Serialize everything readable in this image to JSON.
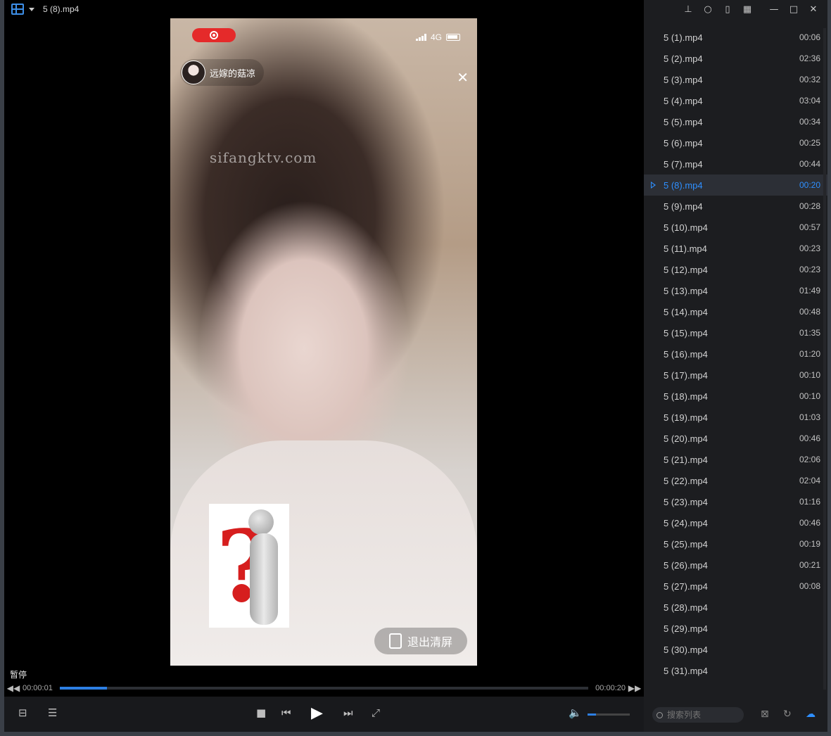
{
  "window": {
    "title": "5 (8).mp4"
  },
  "video": {
    "record_indicator": "◉",
    "network": "4G",
    "username": "远嫁的菇凉",
    "watermark": "sifangktv.com",
    "close_symbol": "✕",
    "clear_screen_label": "退出清屏"
  },
  "playback": {
    "state_label": "暂停",
    "current_time": "00:00:01",
    "total_time": "00:00:20",
    "progress_fraction": 0.09,
    "volume_fraction": 0.2
  },
  "titlebar_buttons": [
    "pin-icon",
    "bulb-icon",
    "window-icon",
    "grid-icon",
    "minimize-icon",
    "maximize-icon",
    "close-icon"
  ],
  "playlist": {
    "items": [
      {
        "name": "5 (1).mp4",
        "duration": "00:06"
      },
      {
        "name": "5 (2).mp4",
        "duration": "02:36"
      },
      {
        "name": "5 (3).mp4",
        "duration": "00:32"
      },
      {
        "name": "5 (4).mp4",
        "duration": "03:04"
      },
      {
        "name": "5 (5).mp4",
        "duration": "00:34"
      },
      {
        "name": "5 (6).mp4",
        "duration": "00:25"
      },
      {
        "name": "5 (7).mp4",
        "duration": "00:44"
      },
      {
        "name": "5 (8).mp4",
        "duration": "00:20",
        "active": true
      },
      {
        "name": "5 (9).mp4",
        "duration": "00:28"
      },
      {
        "name": "5 (10).mp4",
        "duration": "00:57"
      },
      {
        "name": "5 (11).mp4",
        "duration": "00:23"
      },
      {
        "name": "5 (12).mp4",
        "duration": "00:23"
      },
      {
        "name": "5 (13).mp4",
        "duration": "01:49"
      },
      {
        "name": "5 (14).mp4",
        "duration": "00:48"
      },
      {
        "name": "5 (15).mp4",
        "duration": "01:35"
      },
      {
        "name": "5 (16).mp4",
        "duration": "01:20"
      },
      {
        "name": "5 (17).mp4",
        "duration": "00:10"
      },
      {
        "name": "5 (18).mp4",
        "duration": "00:10"
      },
      {
        "name": "5 (19).mp4",
        "duration": "01:03"
      },
      {
        "name": "5 (20).mp4",
        "duration": "00:46"
      },
      {
        "name": "5 (21).mp4",
        "duration": "02:06"
      },
      {
        "name": "5 (22).mp4",
        "duration": "02:04"
      },
      {
        "name": "5 (23).mp4",
        "duration": "01:16"
      },
      {
        "name": "5 (24).mp4",
        "duration": "00:46"
      },
      {
        "name": "5 (25).mp4",
        "duration": "00:19"
      },
      {
        "name": "5 (26).mp4",
        "duration": "00:21"
      },
      {
        "name": "5 (27).mp4",
        "duration": "00:08"
      },
      {
        "name": "5 (28).mp4",
        "duration": ""
      },
      {
        "name": "5 (29).mp4",
        "duration": ""
      },
      {
        "name": "5 (30).mp4",
        "duration": ""
      },
      {
        "name": "5 (31).mp4",
        "duration": ""
      }
    ],
    "search_placeholder": "搜索列表"
  },
  "colors": {
    "accent": "#2e8fff",
    "record": "#e52a2a",
    "background": "#000000",
    "panel": "#1c1d20"
  }
}
